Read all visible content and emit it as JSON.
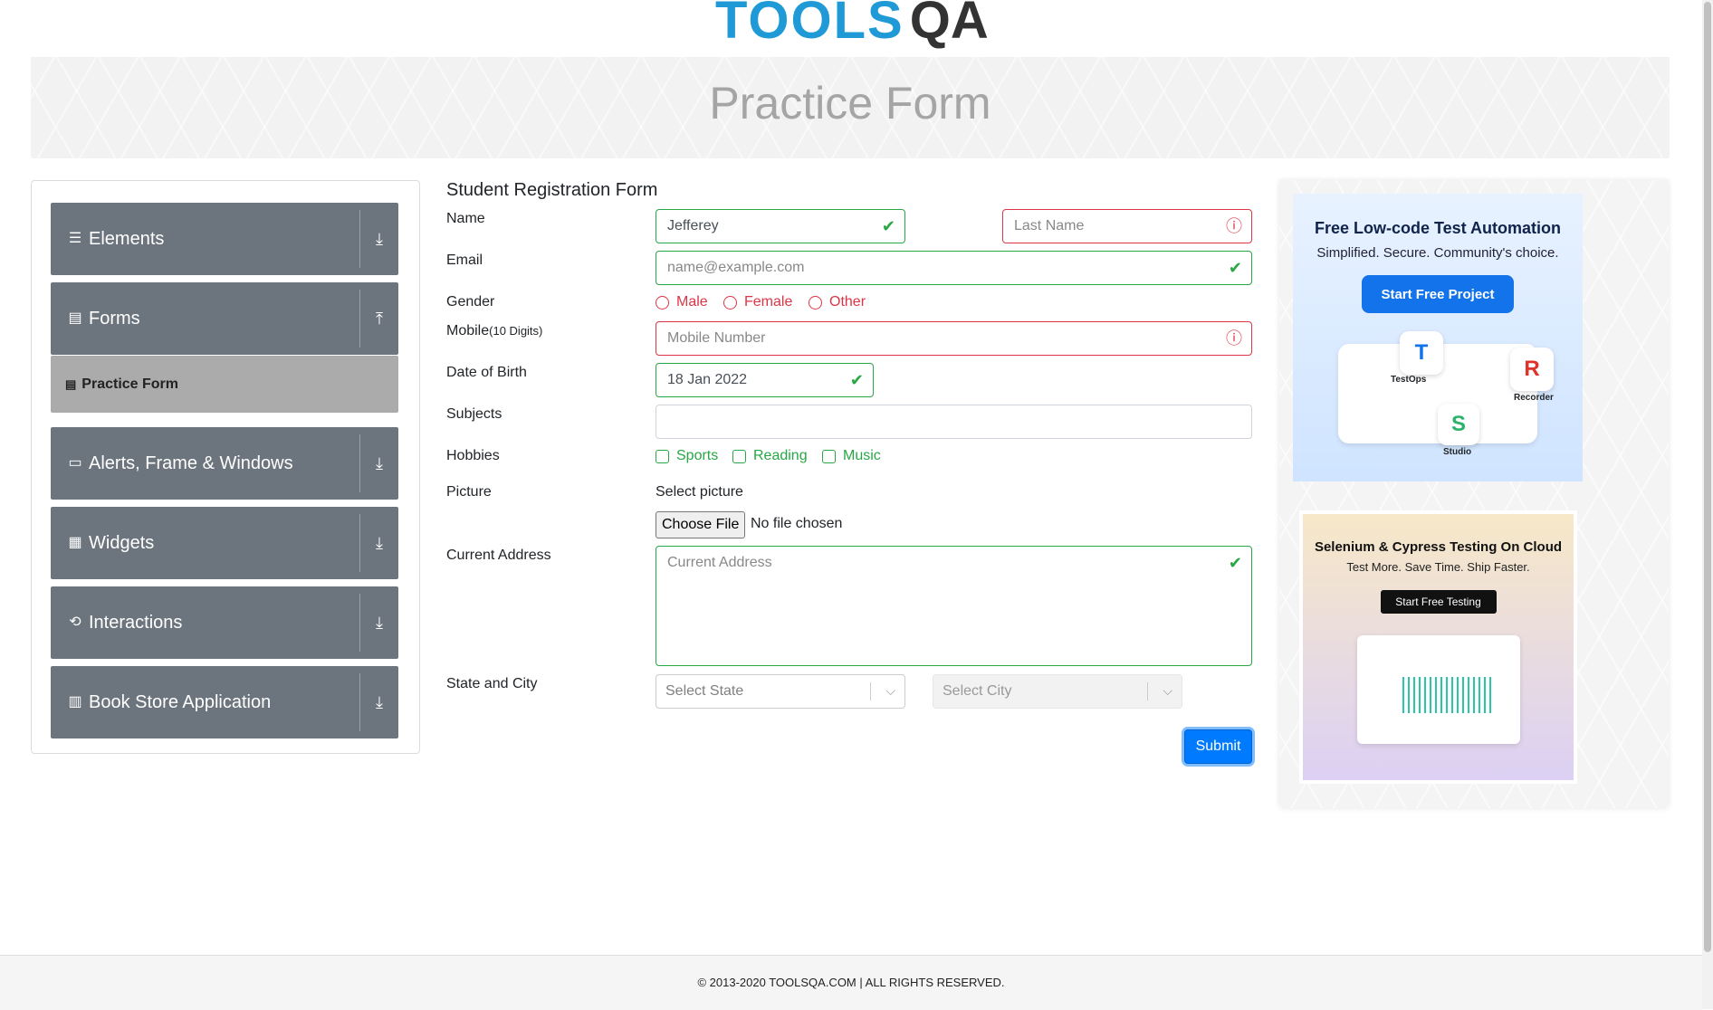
{
  "header": {
    "logo_text": "TOOLS",
    "logo_suffix": "QA"
  },
  "banner": {
    "title": "Practice Form"
  },
  "sidebar": {
    "groups": [
      {
        "label": "Elements",
        "icon": "menu-icon",
        "toggle": "⤓"
      },
      {
        "label": "Forms",
        "icon": "document-icon",
        "toggle": "⤒"
      },
      {
        "label": "Alerts, Frame & Windows",
        "icon": "window-icon",
        "toggle": "⤓"
      },
      {
        "label": "Widgets",
        "icon": "widgets-icon",
        "toggle": "⤓"
      },
      {
        "label": "Interactions",
        "icon": "interactions-icon",
        "toggle": "⤓"
      },
      {
        "label": "Book Store Application",
        "icon": "books-icon",
        "toggle": "⤓"
      }
    ],
    "active_item": "Practice Form"
  },
  "form": {
    "title": "Student Registration Form",
    "labels": {
      "name": "Name",
      "email": "Email",
      "gender": "Gender",
      "mobile": "Mobile",
      "mobile_hint": "(10 Digits)",
      "dob": "Date of Birth",
      "subjects": "Subjects",
      "hobbies": "Hobbies",
      "picture": "Picture",
      "address": "Current Address",
      "state_city": "State and City"
    },
    "first_name_value": "Jefferey",
    "last_name_placeholder": "Last Name",
    "email_placeholder": "name@example.com",
    "gender_options": [
      "Male",
      "Female",
      "Other"
    ],
    "mobile_placeholder": "Mobile Number",
    "dob_value": "18 Jan 2022",
    "subjects_value": "",
    "hobbies": [
      "Sports",
      "Reading",
      "Music"
    ],
    "picture_label": "Select picture",
    "file_button": "Choose File",
    "file_status": "No file chosen",
    "address_placeholder": "Current Address",
    "state_placeholder": "Select State",
    "city_placeholder": "Select City",
    "submit_label": "Submit"
  },
  "ads": {
    "ad1": {
      "title": "Free Low-code Test Automation",
      "subtitle": "Simplified. Secure. Community's choice.",
      "button": "Start Free Project",
      "labels": [
        "TestOps",
        "Recorder",
        "Studio"
      ]
    },
    "ad2": {
      "title": "Selenium & Cypress Testing On Cloud",
      "subtitle": "Test More. Save Time. Ship Faster.",
      "button": "Start Free Testing"
    }
  },
  "footer": {
    "text": "© 2013-2020 TOOLSQA.COM | ALL RIGHTS RESERVED."
  },
  "colors": {
    "valid": "#28a745",
    "invalid": "#dc3545",
    "sidebar": "#6c757d",
    "primary": "#007bff"
  }
}
